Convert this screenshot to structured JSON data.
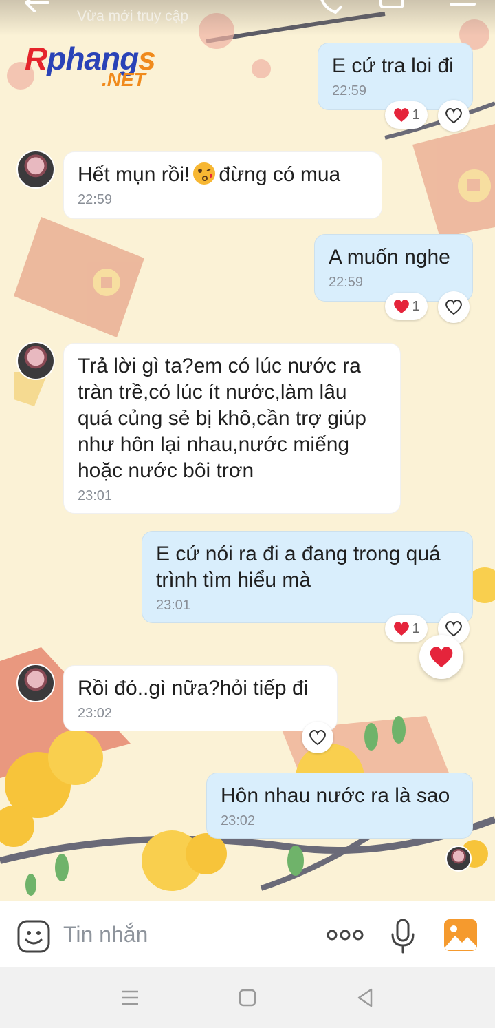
{
  "header": {
    "subtitle": "Vừa mới truy cập"
  },
  "watermark": {
    "brand_r": "R",
    "brand_rest": "phang",
    "brand_s": "s",
    "domain": ".NET"
  },
  "messages": [
    {
      "side": "sent",
      "text": "E cứ tra loi đi",
      "time": "22:59",
      "reaction_count": "1"
    },
    {
      "side": "recv",
      "text_before": "Hết mụn rồi!",
      "emoji": "kissing-face-emoji",
      "text_after": "đừng có mua",
      "time": "22:59"
    },
    {
      "side": "sent",
      "text": "A muốn nghe",
      "time": "22:59",
      "reaction_count": "1"
    },
    {
      "side": "recv",
      "text": "Trả lời gì ta?em có lúc nước ra\ntràn trề,có lúc ít nước,làm lâu\nquá củng sẻ bị khô,cần trợ giúp\nnhư hôn lại nhau,nước miếng\nhoặc nước bôi trơn",
      "time": "23:01"
    },
    {
      "side": "sent",
      "text": "E cứ nói ra đi a đang trong quá\ntrình tìm hiểu mà",
      "time": "23:01",
      "reaction_count": "1"
    },
    {
      "side": "recv",
      "text": "Rồi đó..gì nữa?hỏi tiếp đi",
      "time": "23:02"
    },
    {
      "side": "sent",
      "text": "Hôn nhau nước ra là sao",
      "time": "23:02"
    }
  ],
  "input": {
    "placeholder": "Tin nhắn"
  },
  "colors": {
    "sent_bubble": "#d9eefc",
    "recv_bubble": "#ffffff",
    "heart": "#e5243b",
    "accent_orange": "#f59a2e"
  }
}
